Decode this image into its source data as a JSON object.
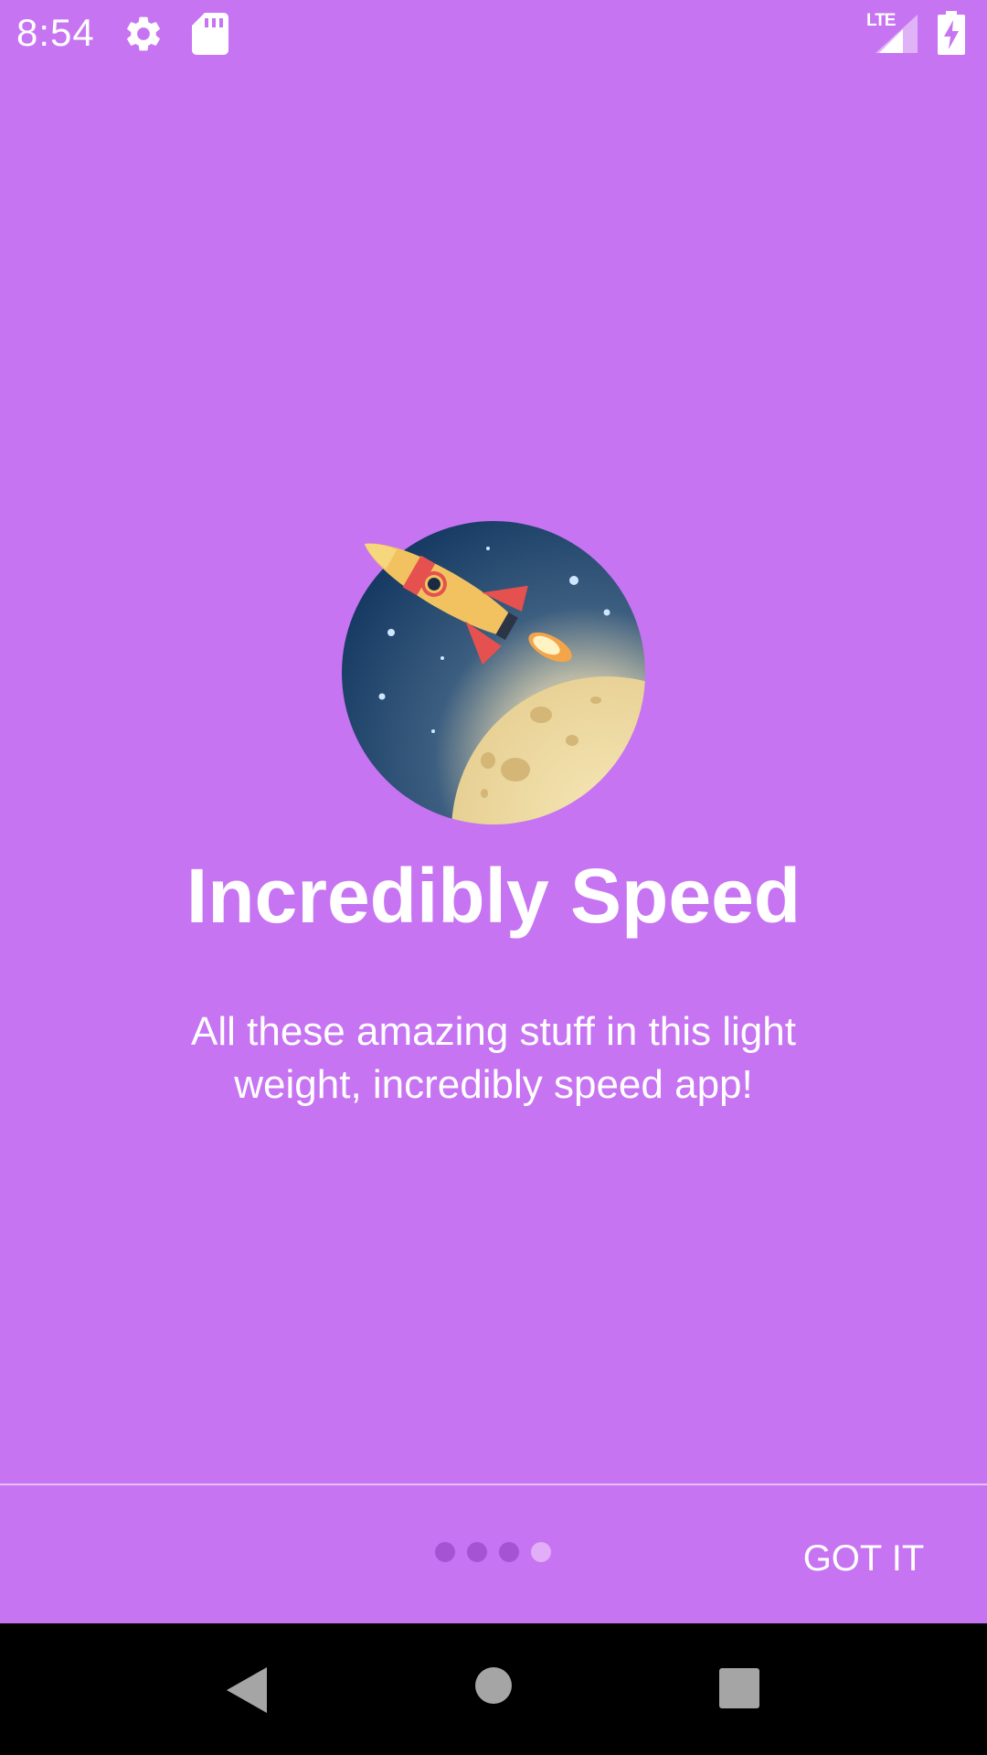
{
  "status_bar": {
    "time": "8:54",
    "network": "LTE",
    "icons": [
      "settings-icon",
      "sd-card-icon",
      "signal-icon",
      "battery-charging-icon"
    ]
  },
  "slide": {
    "illustration": "rocket-moon-illustration",
    "title": "Incredibly Speed",
    "description": "All these amazing stuff in this light weight, incredibly speed app!"
  },
  "pager": {
    "total_pages": 4,
    "current_page": 4
  },
  "actions": {
    "got_it_label": "GOT IT"
  },
  "nav_bar": {
    "icons": [
      "back-icon",
      "home-icon",
      "recents-icon"
    ]
  },
  "colors": {
    "background": "#c774f2",
    "dot_inactive": "#a653d3",
    "dot_active": "#e2aef7",
    "text": "#ffffff"
  }
}
